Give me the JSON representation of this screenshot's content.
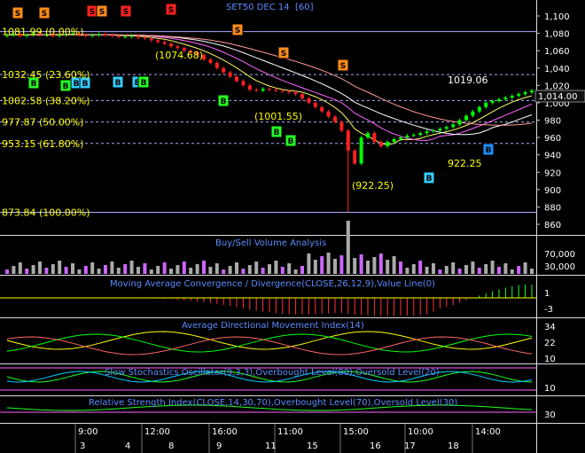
{
  "chart_data": {
    "type": "candlestick",
    "title": "SET50 DEC 14",
    "interval": "[60]",
    "last_price": "1,014.00",
    "colors": {
      "background": "#000000",
      "up": "#00ff00",
      "down": "#ff2020",
      "grid": "#7777ff",
      "axis_text": "#ffffff",
      "title": "#5b8cff",
      "fib_label": "#ffff00"
    },
    "y_axis": {
      "ticks": [
        "1,100",
        "1,080",
        "1,060",
        "1,040",
        "1,020",
        "1,000",
        "980",
        "960",
        "940",
        "920",
        "900",
        "880",
        "860"
      ],
      "values": [
        1100,
        1080,
        1060,
        1040,
        1020,
        1000,
        980,
        960,
        940,
        920,
        900,
        880,
        860
      ],
      "ylim": [
        852,
        1106
      ]
    },
    "fibonacci_levels": [
      {
        "label": "1081.99 (0.00%)",
        "value": 1081.99
      },
      {
        "label": "1032.45 (23.60%)",
        "value": 1032.45
      },
      {
        "label": "1002.58 (38.20%)",
        "value": 1002.58
      },
      {
        "label": "977.87 (50.00%)",
        "value": 977.87
      },
      {
        "label": "953.15 (61.80%)",
        "value": 953.15
      },
      {
        "label": "873.84 (100.00%)",
        "value": 873.84
      }
    ],
    "price_annotations": [
      {
        "text": "(1074.68)",
        "value": 1074.68
      },
      {
        "text": "(1001.55)",
        "value": 1001.55
      },
      {
        "text": "(922.25)",
        "value": 922.25
      },
      {
        "text": "922.25",
        "value": 922.25
      },
      {
        "text": "1019.06",
        "value": 1019.06
      }
    ],
    "signals": [
      {
        "type": "S",
        "color": "#ff8c1a"
      },
      {
        "type": "S",
        "color": "#ff8c1a"
      },
      {
        "type": "S",
        "color": "#ff2020"
      },
      {
        "type": "S",
        "color": "#ff8c1a"
      },
      {
        "type": "S",
        "color": "#ff2020"
      },
      {
        "type": "S",
        "color": "#ff2020"
      },
      {
        "type": "S",
        "color": "#ff8c1a"
      },
      {
        "type": "S",
        "color": "#ff8c1a"
      },
      {
        "type": "S",
        "color": "#ff8c1a"
      },
      {
        "type": "B",
        "color": "#22ff22"
      },
      {
        "type": "B",
        "color": "#22ff22"
      },
      {
        "type": "B",
        "color": "#33ccff"
      },
      {
        "type": "B",
        "color": "#33ccff"
      },
      {
        "type": "B",
        "color": "#33ccff"
      },
      {
        "type": "B",
        "color": "#33ccff"
      },
      {
        "type": "B",
        "color": "#22ff22"
      },
      {
        "type": "B",
        "color": "#22ff22"
      },
      {
        "type": "B",
        "color": "#22ff22"
      },
      {
        "type": "B",
        "color": "#22ff22"
      },
      {
        "type": "B",
        "color": "#33ccff"
      },
      {
        "type": "B",
        "color": "#1e90ff"
      }
    ],
    "close_series": [
      1078,
      1079,
      1077,
      1078,
      1080,
      1078,
      1079,
      1077,
      1078,
      1079,
      1080,
      1078,
      1077,
      1078,
      1079,
      1078,
      1077,
      1076,
      1076,
      1077,
      1075,
      1074,
      1072,
      1070,
      1068,
      1065,
      1063,
      1060,
      1058,
      1055,
      1050,
      1046,
      1040,
      1035,
      1030,
      1025,
      1020,
      1015,
      1014,
      1016,
      1015,
      1014,
      1013,
      1012,
      1010,
      1005,
      1000,
      995,
      990,
      984,
      978,
      968,
      945,
      930,
      960,
      965,
      955,
      950,
      955,
      958,
      960,
      962,
      963,
      965,
      967,
      968,
      970,
      972,
      975,
      980,
      985,
      990,
      995,
      1000,
      1002,
      1004,
      1006,
      1008,
      1010,
      1012,
      1014
    ],
    "volume_panel": {
      "title": "Buy/Sell Volume Analysis",
      "ticks": [
        "70,000",
        "30,000"
      ],
      "values": [
        70000,
        30000
      ]
    },
    "macd_panel": {
      "title": "Moving Average Convergence / Divergence(CLOSE,26,12,9),Value Line(0)",
      "ticks": [
        "1",
        "-3"
      ],
      "values": [
        1,
        -3
      ]
    },
    "adx_panel": {
      "title": "Average Directional Movement Index(14)",
      "ticks": [
        "34",
        "22",
        "10"
      ],
      "values": [
        34,
        22,
        10
      ]
    },
    "stoch_panel": {
      "title": "Slow Stochastics Oscillator(9,3,3),Overbought Level(80),Oversold Level(20)",
      "ticks": [
        "10"
      ],
      "values": [
        10
      ]
    },
    "rsi_panel": {
      "title": "Relative Strength Index(CLOSE,14,30,70),Overbought Level(70),Oversold Level(30)",
      "ticks": [
        "30"
      ],
      "values": [
        30
      ]
    },
    "x_axis": {
      "time_labels": [
        "9:00",
        "12:00",
        "16:00",
        "11:00",
        "15:00",
        "10:00",
        "14:00"
      ],
      "date_labels": [
        "3",
        "4",
        "8",
        "9",
        "11",
        "15",
        "16",
        "17",
        "18"
      ]
    }
  }
}
